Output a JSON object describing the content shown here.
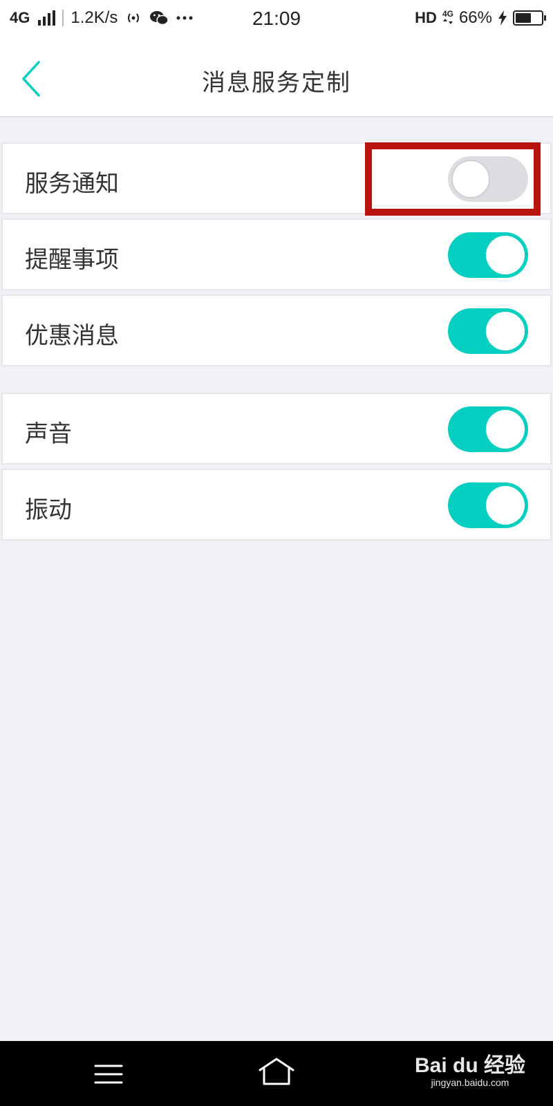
{
  "status_bar": {
    "network": "4G",
    "speed": "1.2K/s",
    "time": "21:09",
    "hd": "HD",
    "network_small": "4G",
    "battery": "66%",
    "battery_level": 0.66
  },
  "header": {
    "title": "消息服务定制",
    "back_icon": "chevron-left-icon"
  },
  "settings_groups": [
    [
      {
        "label": "服务通知",
        "enabled": false
      },
      {
        "label": "提醒事项",
        "enabled": true
      },
      {
        "label": "优惠消息",
        "enabled": true
      }
    ],
    [
      {
        "label": "声音",
        "enabled": true
      },
      {
        "label": "振动",
        "enabled": true
      }
    ]
  ],
  "colors": {
    "accent": "#05cfc1",
    "toggle_off": "#dddce0",
    "highlight": "#b8140e",
    "background": "#f1f0f4"
  },
  "nav_bar": {
    "menu_icon": "menu-icon",
    "home_icon": "home-icon"
  },
  "watermark": {
    "logo": "Bai du 经验",
    "url": "jingyan.baidu.com"
  }
}
